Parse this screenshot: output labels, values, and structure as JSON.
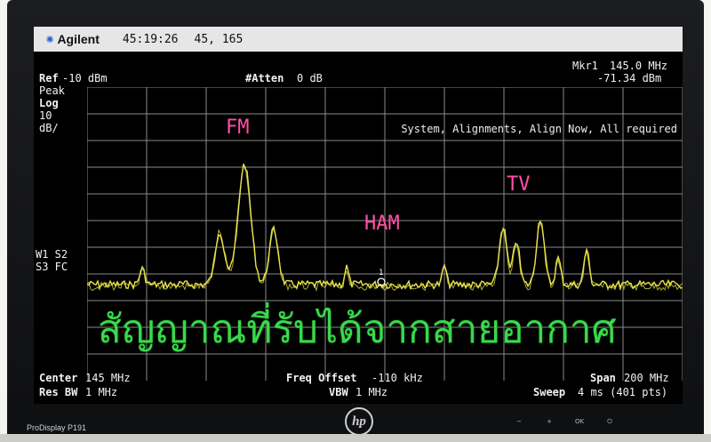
{
  "topbar": {
    "logo_icon": "agilent-starburst-icon",
    "brand": "Agilent",
    "clock": "45:19:26",
    "coords": "45, 165"
  },
  "header": {
    "ref_label": "Ref",
    "ref_value": "-10 dBm",
    "atten_label": "#Atten",
    "atten_value": "0 dB",
    "marker_label": "Mkr1",
    "marker_freq": "145.0 MHz",
    "marker_level": "-71.34 dBm"
  },
  "left_panel": {
    "detector": "Peak",
    "scale": "Log",
    "div_value": "10",
    "div_unit": "dB/",
    "trace_line1": "W1 S2",
    "trace_line2": "S3 FC"
  },
  "status_message": "System, Alignments, Align Now, All required",
  "annotations": {
    "fm": "FM",
    "tv": "TV",
    "ham": "HAM"
  },
  "caption": "สัญญาณที่รับได้จากสายอากาศ",
  "footer": {
    "center_label": "Center",
    "center_value": "145 MHz",
    "res_bw_label": "Res BW",
    "res_bw_value": "1 MHz",
    "freq_offset_label": "Freq Offset",
    "freq_offset_value": "-110 kHz",
    "vbw_label": "VBW",
    "vbw_value": "1 MHz",
    "span_label": "Span",
    "span_value": "200 MHz",
    "sweep_label": "Sweep",
    "sweep_value": "4 ms (401 pts)"
  },
  "bezel": {
    "model": "ProDisplay P191",
    "logo_text": "hp",
    "buttons": [
      "−",
      "+",
      "OK",
      "⏻"
    ]
  },
  "colors": {
    "trace": "#e8e34a",
    "annotation": "#ff4fa8",
    "caption": "#39d94a",
    "graticule": "#8a8a8a"
  }
}
